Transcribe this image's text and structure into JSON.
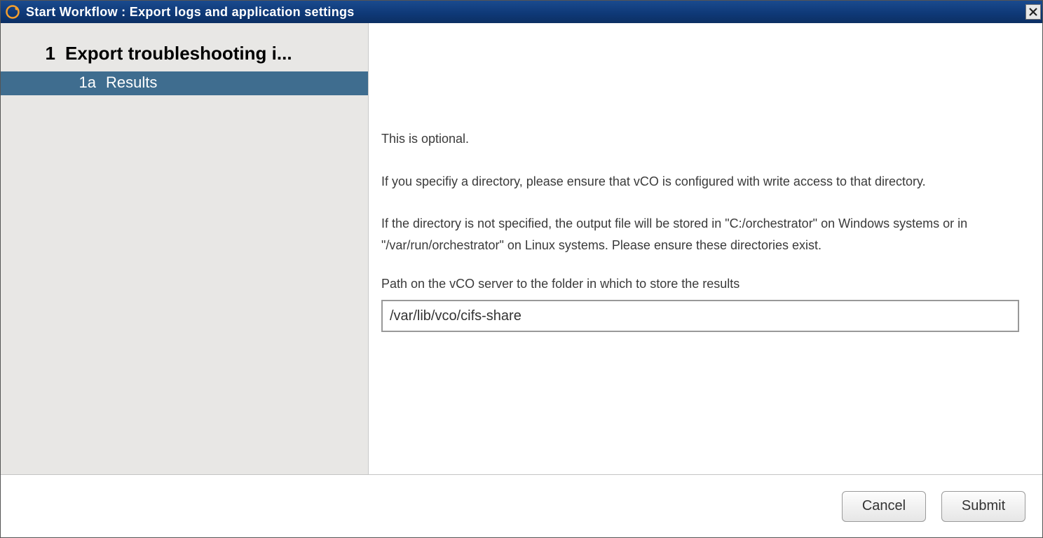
{
  "titlebar": {
    "title": "Start Workflow : Export logs and application settings"
  },
  "sidebar": {
    "step": {
      "number": "1",
      "label": "Export troubleshooting i..."
    },
    "substep": {
      "id": "1a",
      "label": "Results"
    }
  },
  "content": {
    "para1": "This is optional.",
    "para2": "If you specifiy a directory, please ensure that vCO is configured with write access to that directory.",
    "para3": "If the directory is not specified, the output file will be stored in \"C:/orchestrator\" on Windows systems or in \"/var/run/orchestrator\" on Linux systems. Please ensure these directories exist.",
    "field_label": "Path on the vCO server to the folder in which to store the results",
    "path_value": "/var/lib/vco/cifs-share"
  },
  "footer": {
    "cancel": "Cancel",
    "submit": "Submit"
  }
}
